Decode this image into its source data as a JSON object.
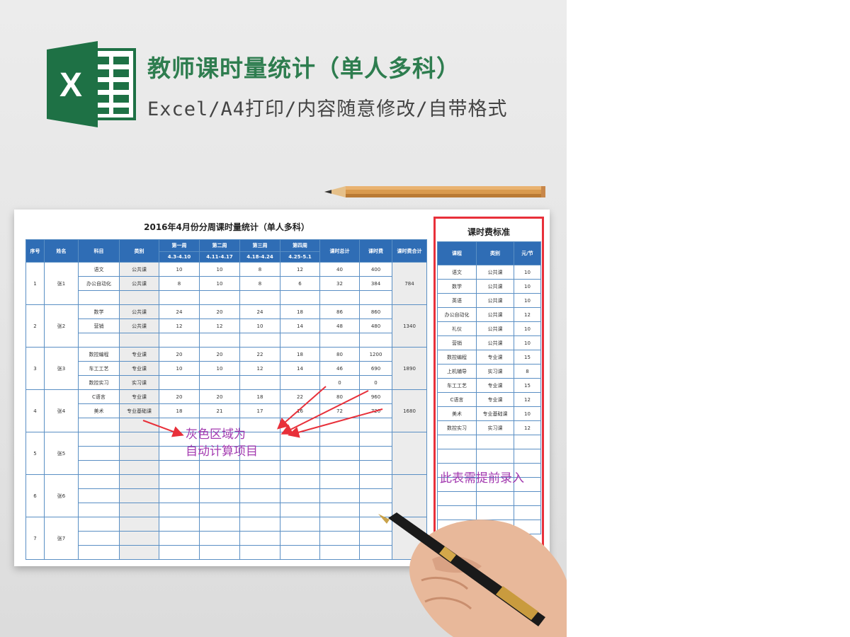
{
  "header": {
    "title": "教师课时量统计（单人多科）",
    "subtitle": "Excel/A4打印/内容随意修改/自带格式",
    "logo_letter": "X",
    "logo_color": "#1e7145"
  },
  "sheet": {
    "title": "2016年4月份分周课时量统计（单人多科）",
    "headers": {
      "seq": "序号",
      "name": "姓名",
      "subject": "科目",
      "category": "类别",
      "week1": "第一周",
      "week2": "第二周",
      "week3": "第三周",
      "week4": "第四周",
      "week1_range": "4.3-4.10",
      "week2_range": "4.11-4.17",
      "week3_range": "4.18-4.24",
      "week4_range": "4.25-5.1",
      "hours_total": "课时总计",
      "fee": "课时费",
      "fee_total": "课时费合计"
    },
    "teachers": [
      {
        "seq": "1",
        "name": "张1",
        "fee_total": "784",
        "rows": [
          {
            "subject": "语文",
            "category": "公共课",
            "w1": "10",
            "w2": "10",
            "w3": "8",
            "w4": "12",
            "hours": "40",
            "fee": "400"
          },
          {
            "subject": "办公自动化",
            "category": "公共课",
            "w1": "8",
            "w2": "10",
            "w3": "8",
            "w4": "6",
            "hours": "32",
            "fee": "384"
          },
          {
            "subject": "",
            "category": "",
            "w1": "",
            "w2": "",
            "w3": "",
            "w4": "",
            "hours": "",
            "fee": ""
          }
        ]
      },
      {
        "seq": "2",
        "name": "张2",
        "fee_total": "1340",
        "rows": [
          {
            "subject": "数学",
            "category": "公共课",
            "w1": "24",
            "w2": "20",
            "w3": "24",
            "w4": "18",
            "hours": "86",
            "fee": "860"
          },
          {
            "subject": "营销",
            "category": "公共课",
            "w1": "12",
            "w2": "12",
            "w3": "10",
            "w4": "14",
            "hours": "48",
            "fee": "480"
          },
          {
            "subject": "",
            "category": "",
            "w1": "",
            "w2": "",
            "w3": "",
            "w4": "",
            "hours": "",
            "fee": ""
          }
        ]
      },
      {
        "seq": "3",
        "name": "张3",
        "fee_total": "1890",
        "rows": [
          {
            "subject": "数控编程",
            "category": "专业课",
            "w1": "20",
            "w2": "20",
            "w3": "22",
            "w4": "18",
            "hours": "80",
            "fee": "1200"
          },
          {
            "subject": "车工工艺",
            "category": "专业课",
            "w1": "10",
            "w2": "10",
            "w3": "12",
            "w4": "14",
            "hours": "46",
            "fee": "690"
          },
          {
            "subject": "数控实习",
            "category": "实习课",
            "w1": "",
            "w2": "",
            "w3": "",
            "w4": "",
            "hours": "0",
            "fee": "0"
          }
        ]
      },
      {
        "seq": "4",
        "name": "张4",
        "fee_total": "1680",
        "rows": [
          {
            "subject": "C语言",
            "category": "专业课",
            "w1": "20",
            "w2": "20",
            "w3": "18",
            "w4": "22",
            "hours": "80",
            "fee": "960"
          },
          {
            "subject": "美术",
            "category": "专业基础课",
            "w1": "18",
            "w2": "21",
            "w3": "17",
            "w4": "16",
            "hours": "72",
            "fee": "720"
          },
          {
            "subject": "",
            "category": "",
            "w1": "",
            "w2": "",
            "w3": "",
            "w4": "",
            "hours": "",
            "fee": ""
          }
        ]
      },
      {
        "seq": "5",
        "name": "张5",
        "fee_total": "",
        "rows": [
          {
            "subject": "",
            "category": "",
            "w1": "",
            "w2": "",
            "w3": "",
            "w4": "",
            "hours": "",
            "fee": ""
          },
          {
            "subject": "",
            "category": "",
            "w1": "",
            "w2": "",
            "w3": "",
            "w4": "",
            "hours": "",
            "fee": ""
          },
          {
            "subject": "",
            "category": "",
            "w1": "",
            "w2": "",
            "w3": "",
            "w4": "",
            "hours": "",
            "fee": ""
          }
        ]
      },
      {
        "seq": "6",
        "name": "张6",
        "fee_total": "",
        "rows": [
          {
            "subject": "",
            "category": "",
            "w1": "",
            "w2": "",
            "w3": "",
            "w4": "",
            "hours": "",
            "fee": ""
          },
          {
            "subject": "",
            "category": "",
            "w1": "",
            "w2": "",
            "w3": "",
            "w4": "",
            "hours": "",
            "fee": ""
          },
          {
            "subject": "",
            "category": "",
            "w1": "",
            "w2": "",
            "w3": "",
            "w4": "",
            "hours": "",
            "fee": ""
          }
        ]
      },
      {
        "seq": "7",
        "name": "张7",
        "fee_total": "",
        "rows": [
          {
            "subject": "",
            "category": "",
            "w1": "",
            "w2": "",
            "w3": "",
            "w4": "",
            "hours": "",
            "fee": ""
          },
          {
            "subject": "",
            "category": "",
            "w1": "",
            "w2": "",
            "w3": "",
            "w4": "",
            "hours": "",
            "fee": ""
          },
          {
            "subject": "",
            "category": "",
            "w1": "",
            "w2": "",
            "w3": "",
            "w4": "",
            "hours": "",
            "fee": ""
          }
        ]
      }
    ]
  },
  "rate_table": {
    "title": "课时费标准",
    "headers": {
      "course": "课程",
      "category": "类别",
      "unit": "元/节"
    },
    "rows": [
      {
        "course": "语文",
        "category": "公共课",
        "price": "10"
      },
      {
        "course": "数学",
        "category": "公共课",
        "price": "10"
      },
      {
        "course": "英语",
        "category": "公共课",
        "price": "10"
      },
      {
        "course": "办公自动化",
        "category": "公共课",
        "price": "12"
      },
      {
        "course": "礼仪",
        "category": "公共课",
        "price": "10"
      },
      {
        "course": "营销",
        "category": "公共课",
        "price": "10"
      },
      {
        "course": "数控编程",
        "category": "专业课",
        "price": "15"
      },
      {
        "course": "上机辅导",
        "category": "实习课",
        "price": "8"
      },
      {
        "course": "车工工艺",
        "category": "专业课",
        "price": "15"
      },
      {
        "course": "C语言",
        "category": "专业课",
        "price": "12"
      },
      {
        "course": "美术",
        "category": "专业基础课",
        "price": "10"
      },
      {
        "course": "数控实习",
        "category": "实习课",
        "price": "12"
      },
      {
        "course": "",
        "category": "",
        "price": ""
      },
      {
        "course": "",
        "category": "",
        "price": ""
      },
      {
        "course": "",
        "category": "",
        "price": ""
      },
      {
        "course": "",
        "category": "",
        "price": ""
      },
      {
        "course": "",
        "category": "",
        "price": ""
      },
      {
        "course": "",
        "category": "",
        "price": ""
      },
      {
        "course": "",
        "category": "",
        "price": ""
      }
    ]
  },
  "annotations": {
    "gray_note_line1": "灰色区域为",
    "gray_note_line2": "自动计算项目",
    "right_note": "此表需提前录入",
    "annotation_color": "#a33ab0",
    "arrow_color": "#e8303a"
  }
}
